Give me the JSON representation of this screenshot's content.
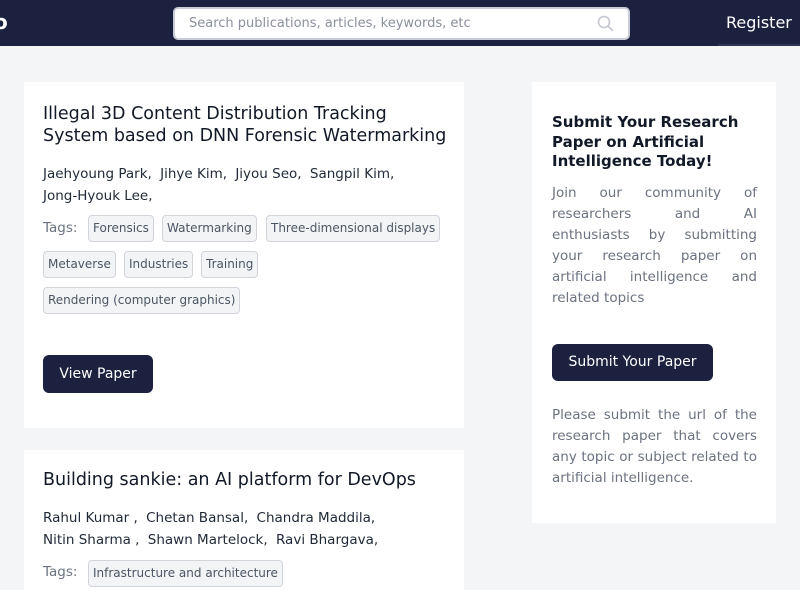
{
  "header": {
    "search_placeholder": "Search publications, articles, keywords, etc",
    "register_label": "Register",
    "logo_fragment": "o"
  },
  "papers": [
    {
      "title": "Illegal 3D Content Distribution Tracking System based on DNN Forensic Watermarking",
      "authors": [
        "Jaehyoung Park,",
        "Jihye Kim,",
        "Jiyou Seo,",
        "Sangpil Kim,",
        "Jong-Hyouk Lee,"
      ],
      "tags_label": "Tags:",
      "tags": [
        "Forensics",
        "Watermarking",
        "Three-dimensional displays",
        "Metaverse",
        "Industries",
        "Training",
        "Rendering (computer graphics)"
      ],
      "view_label": "View Paper"
    },
    {
      "title": "Building sankie: an AI platform for DevOps",
      "authors": [
        "Rahul Kumar ,",
        "Chetan Bansal,",
        "Chandra Maddila,",
        "Nitin Sharma ,",
        "Shawn Martelock,",
        "Ravi Bhargava,"
      ],
      "tags_label": "Tags:",
      "tags": [
        "Infrastructure and architecture"
      ]
    }
  ],
  "sidebar": {
    "title": "Submit Your Research Paper on Artificial Intelligence Today!",
    "description": "Join our community of researchers and AI enthusiasts by submitting your research paper on artificial intelligence and related topics",
    "submit_label": "Submit Your Paper",
    "note": "Please submit the url of the research paper that covers any topic or subject related to artificial intelligence."
  },
  "colors": {
    "navy": "#1d2140",
    "background": "#f4f5f7"
  }
}
